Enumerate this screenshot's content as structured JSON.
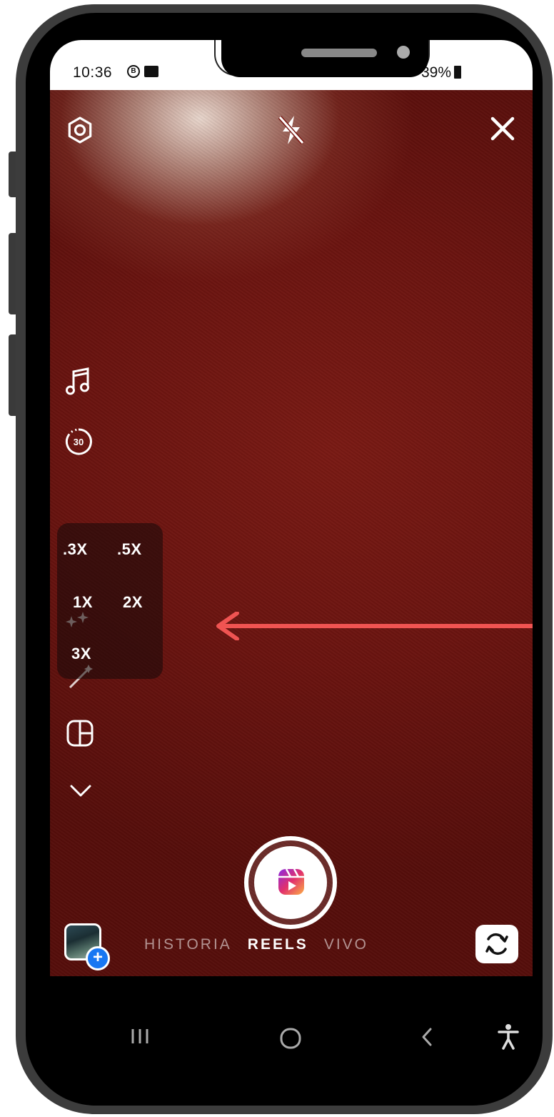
{
  "status_bar": {
    "time": "10:36",
    "left_icons": [
      "b-badge-icon",
      "gallery-icon"
    ],
    "battery_text": "39%"
  },
  "camera_top": {
    "settings_icon": "gear-icon",
    "flash_icon": "flash-off-icon",
    "close_icon": "close-icon"
  },
  "left_tools": {
    "music_icon": "music-note-icon",
    "timer_label": "30",
    "layout_icon": "layout-grid-icon",
    "more_icon": "chevron-down-icon"
  },
  "zoom_options": [
    ".3X",
    ".5X",
    "1X",
    "2X",
    "3X"
  ],
  "shutter": {
    "mode_icon": "reels-icon"
  },
  "modes": [
    "HISTORIA",
    "REELS",
    "VIVO"
  ],
  "active_mode": "REELS",
  "gallery_badge": "+",
  "colors": {
    "viewfinder": "#6b1410",
    "arrow": "#f05452",
    "badge": "#1877f2"
  }
}
